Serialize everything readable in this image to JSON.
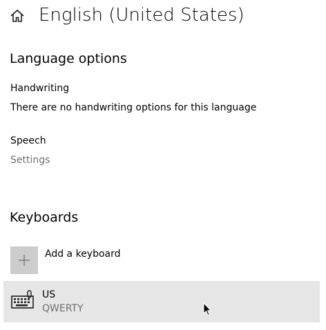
{
  "header": {
    "title": "English (United States)",
    "home_icon": "home-icon"
  },
  "language_options": {
    "title": "Language options",
    "handwriting_label": "Handwriting",
    "handwriting_text": "There are no handwriting options for this language",
    "speech_label": "Speech",
    "speech_settings_link": "Settings"
  },
  "keyboards": {
    "title": "Keyboards",
    "add_label": "Add a keyboard",
    "add_icon": "plus-icon",
    "items": [
      {
        "name": "US",
        "layout": "QWERTY",
        "icon": "keyboard-icon",
        "selected": true
      }
    ]
  },
  "colors": {
    "accent_gray_text": "#6e6e6e",
    "tile_gray": "#cccccc",
    "selected_row": "#e6e6e6"
  }
}
